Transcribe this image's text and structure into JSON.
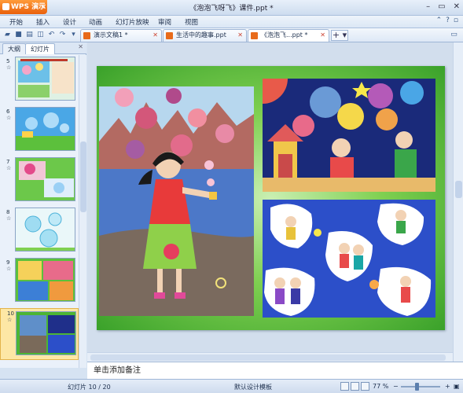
{
  "app": {
    "name": "WPS 演示",
    "window_title": "《泡泡飞呀飞》课件.ppt *"
  },
  "menu": [
    {
      "label": "开始"
    },
    {
      "label": "插入"
    },
    {
      "label": "设计"
    },
    {
      "label": "动画"
    },
    {
      "label": "幻灯片放映"
    },
    {
      "label": "审阅"
    },
    {
      "label": "视图"
    }
  ],
  "tabs": [
    {
      "label": "演示文稿1 *"
    },
    {
      "label": "生活中的趣事.ppt"
    },
    {
      "label": "《泡泡飞...ppt *"
    }
  ],
  "panel": {
    "tab_outline": "大纲",
    "tab_slides": "幻灯片"
  },
  "slides": [
    {
      "num": "5"
    },
    {
      "num": "6"
    },
    {
      "num": "7"
    },
    {
      "num": "8"
    },
    {
      "num": "9"
    },
    {
      "num": "10"
    }
  ],
  "notes_placeholder": "单击添加备注",
  "status": {
    "slide_info": "幻灯片 10 / 20",
    "template": "默认设计模板",
    "zoom": "77 %"
  },
  "colors": {
    "accent": "#e9600b",
    "slide_bg": "#3aa12a"
  }
}
